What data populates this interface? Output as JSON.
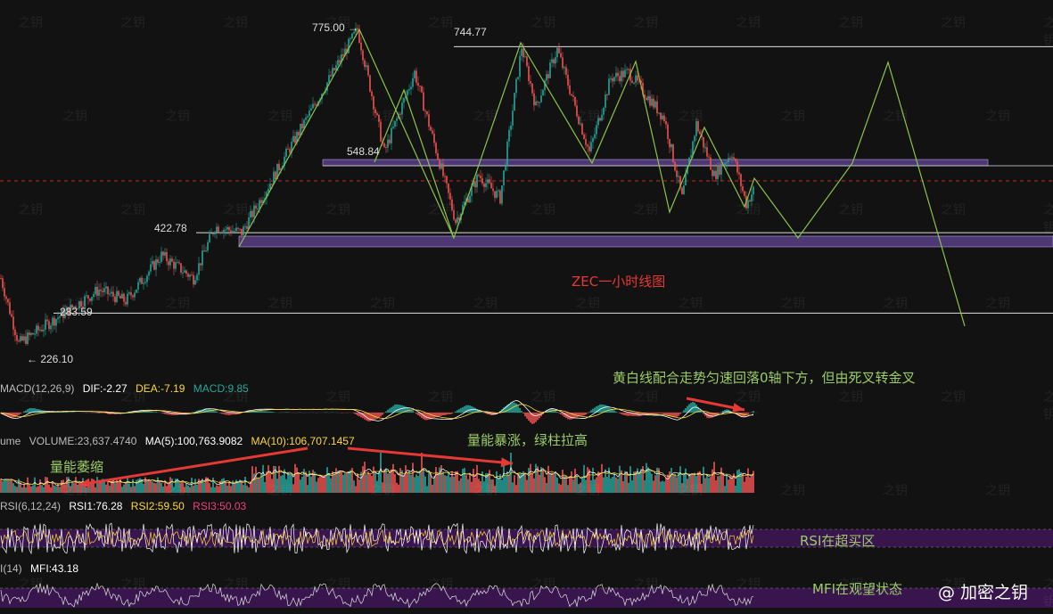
{
  "chart_data": {
    "type": "candlestick",
    "title": "ZEC一小时线图",
    "price_levels": [
      {
        "label": "775.00 →",
        "value": 775.0
      },
      {
        "label": "744.77",
        "value": 744.77
      },
      {
        "label": "548.84",
        "value": 548.84
      },
      {
        "label": "422.78",
        "value": 422.78
      },
      {
        "label": "283.59",
        "value": 283.59
      },
      {
        "label": "← 226.10",
        "value": 226.1
      }
    ],
    "ylim": [
      200,
      800
    ],
    "zigzag_path": [
      {
        "bar": 0,
        "price": 422.78
      },
      {
        "bar": 100,
        "price": 775
      },
      {
        "bar": 160,
        "price": 430
      },
      {
        "bar": 195,
        "price": 744.77
      },
      {
        "bar": 235,
        "price": 530
      },
      {
        "bar": 260,
        "price": 718
      },
      {
        "bar": 280,
        "price": 466
      },
      {
        "bar": 295,
        "price": 620
      },
      {
        "bar": 312,
        "price": 470
      },
      {
        "bar": 335,
        "price": 505
      },
      {
        "bar": 360,
        "price": 430
      },
      {
        "bar": 383,
        "price": 530
      },
      {
        "bar": 397,
        "price": 722
      },
      {
        "bar": 428,
        "price": 300
      }
    ],
    "indicators": {
      "macd": {
        "label": "MACD(12,26,9)",
        "dif": "DIF:-2.27",
        "dea": "DEA:-7.19",
        "macd": "MACD:9.85"
      },
      "volume": {
        "label": "ume",
        "volume": "VOLUME:23,637.4740",
        "ma5": "MA(5):100,763.9082",
        "ma10": "MA(10):106,707.1457"
      },
      "rsi": {
        "label": "RSI(6,12,24)",
        "rsi1": "RSI1:76.28",
        "rsi2": "RSI2:59.50",
        "rsi3": "RSI3:50.03"
      },
      "mfi": {
        "label": "I(14)",
        "mfi": "MFI:43.18"
      }
    }
  },
  "annotations": {
    "macd_note": "黄白线配合走势匀速回落0轴下方，但由死叉转金叉",
    "volume_up": "量能暴涨，绿柱拉高",
    "volume_down": "量能萎缩",
    "rsi_note": "RSI在超买区",
    "mfi_note": "MFI在观望状态"
  },
  "watermark": "之钥",
  "brand": "@ 加密之钥",
  "colors": {
    "up": "#26a69a",
    "down": "#ef5350",
    "zigzag": "#8bc34a",
    "band": "#7e57c2",
    "note": "#9ccc65",
    "title": "#e53935"
  }
}
